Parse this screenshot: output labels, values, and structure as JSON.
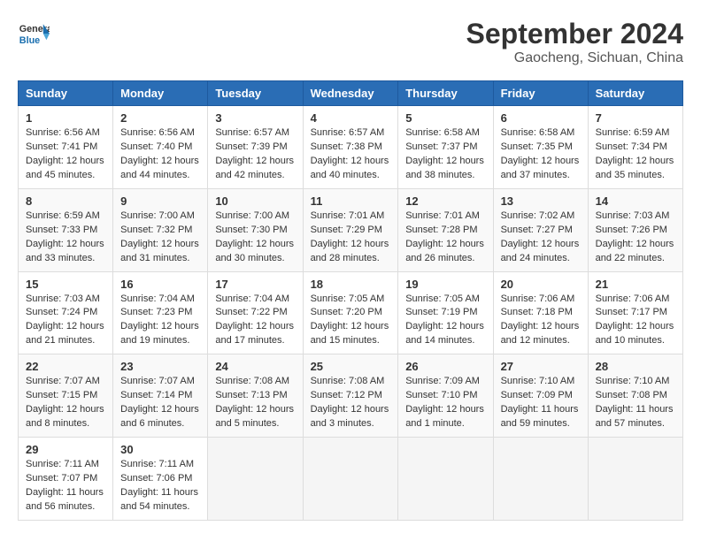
{
  "header": {
    "logo_line1": "General",
    "logo_line2": "Blue",
    "month": "September 2024",
    "location": "Gaocheng, Sichuan, China"
  },
  "weekdays": [
    "Sunday",
    "Monday",
    "Tuesday",
    "Wednesday",
    "Thursday",
    "Friday",
    "Saturday"
  ],
  "weeks": [
    [
      {
        "day": "1",
        "sunrise": "6:56 AM",
        "sunset": "7:41 PM",
        "daylight": "12 hours and 45 minutes."
      },
      {
        "day": "2",
        "sunrise": "6:56 AM",
        "sunset": "7:40 PM",
        "daylight": "12 hours and 44 minutes."
      },
      {
        "day": "3",
        "sunrise": "6:57 AM",
        "sunset": "7:39 PM",
        "daylight": "12 hours and 42 minutes."
      },
      {
        "day": "4",
        "sunrise": "6:57 AM",
        "sunset": "7:38 PM",
        "daylight": "12 hours and 40 minutes."
      },
      {
        "day": "5",
        "sunrise": "6:58 AM",
        "sunset": "7:37 PM",
        "daylight": "12 hours and 38 minutes."
      },
      {
        "day": "6",
        "sunrise": "6:58 AM",
        "sunset": "7:35 PM",
        "daylight": "12 hours and 37 minutes."
      },
      {
        "day": "7",
        "sunrise": "6:59 AM",
        "sunset": "7:34 PM",
        "daylight": "12 hours and 35 minutes."
      }
    ],
    [
      {
        "day": "8",
        "sunrise": "6:59 AM",
        "sunset": "7:33 PM",
        "daylight": "12 hours and 33 minutes."
      },
      {
        "day": "9",
        "sunrise": "7:00 AM",
        "sunset": "7:32 PM",
        "daylight": "12 hours and 31 minutes."
      },
      {
        "day": "10",
        "sunrise": "7:00 AM",
        "sunset": "7:30 PM",
        "daylight": "12 hours and 30 minutes."
      },
      {
        "day": "11",
        "sunrise": "7:01 AM",
        "sunset": "7:29 PM",
        "daylight": "12 hours and 28 minutes."
      },
      {
        "day": "12",
        "sunrise": "7:01 AM",
        "sunset": "7:28 PM",
        "daylight": "12 hours and 26 minutes."
      },
      {
        "day": "13",
        "sunrise": "7:02 AM",
        "sunset": "7:27 PM",
        "daylight": "12 hours and 24 minutes."
      },
      {
        "day": "14",
        "sunrise": "7:03 AM",
        "sunset": "7:26 PM",
        "daylight": "12 hours and 22 minutes."
      }
    ],
    [
      {
        "day": "15",
        "sunrise": "7:03 AM",
        "sunset": "7:24 PM",
        "daylight": "12 hours and 21 minutes."
      },
      {
        "day": "16",
        "sunrise": "7:04 AM",
        "sunset": "7:23 PM",
        "daylight": "12 hours and 19 minutes."
      },
      {
        "day": "17",
        "sunrise": "7:04 AM",
        "sunset": "7:22 PM",
        "daylight": "12 hours and 17 minutes."
      },
      {
        "day": "18",
        "sunrise": "7:05 AM",
        "sunset": "7:20 PM",
        "daylight": "12 hours and 15 minutes."
      },
      {
        "day": "19",
        "sunrise": "7:05 AM",
        "sunset": "7:19 PM",
        "daylight": "12 hours and 14 minutes."
      },
      {
        "day": "20",
        "sunrise": "7:06 AM",
        "sunset": "7:18 PM",
        "daylight": "12 hours and 12 minutes."
      },
      {
        "day": "21",
        "sunrise": "7:06 AM",
        "sunset": "7:17 PM",
        "daylight": "12 hours and 10 minutes."
      }
    ],
    [
      {
        "day": "22",
        "sunrise": "7:07 AM",
        "sunset": "7:15 PM",
        "daylight": "12 hours and 8 minutes."
      },
      {
        "day": "23",
        "sunrise": "7:07 AM",
        "sunset": "7:14 PM",
        "daylight": "12 hours and 6 minutes."
      },
      {
        "day": "24",
        "sunrise": "7:08 AM",
        "sunset": "7:13 PM",
        "daylight": "12 hours and 5 minutes."
      },
      {
        "day": "25",
        "sunrise": "7:08 AM",
        "sunset": "7:12 PM",
        "daylight": "12 hours and 3 minutes."
      },
      {
        "day": "26",
        "sunrise": "7:09 AM",
        "sunset": "7:10 PM",
        "daylight": "12 hours and 1 minute."
      },
      {
        "day": "27",
        "sunrise": "7:10 AM",
        "sunset": "7:09 PM",
        "daylight": "11 hours and 59 minutes."
      },
      {
        "day": "28",
        "sunrise": "7:10 AM",
        "sunset": "7:08 PM",
        "daylight": "11 hours and 57 minutes."
      }
    ],
    [
      {
        "day": "29",
        "sunrise": "7:11 AM",
        "sunset": "7:07 PM",
        "daylight": "11 hours and 56 minutes."
      },
      {
        "day": "30",
        "sunrise": "7:11 AM",
        "sunset": "7:06 PM",
        "daylight": "11 hours and 54 minutes."
      },
      null,
      null,
      null,
      null,
      null
    ]
  ]
}
